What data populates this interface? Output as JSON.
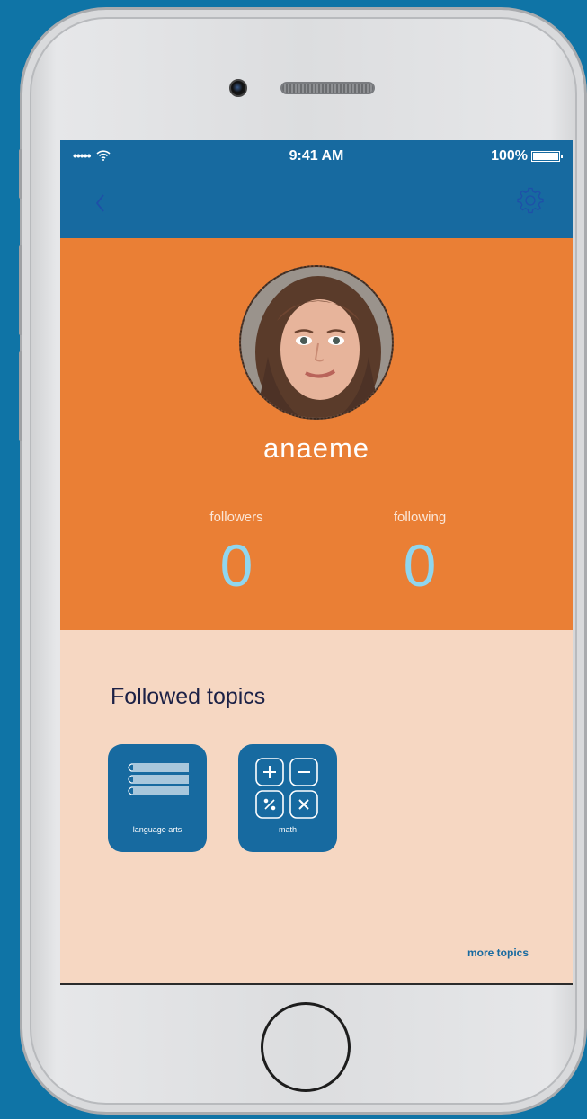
{
  "status_bar": {
    "carrier_signal": "•••••",
    "wifi_icon": "wifi-icon",
    "time": "9:41 AM",
    "battery": "100%"
  },
  "nav": {
    "back_icon": "chevron-left-icon",
    "settings_icon": "gear-icon"
  },
  "profile": {
    "username": "anaeme",
    "followers_label": "followers",
    "followers_count": "0",
    "following_label": "following",
    "following_count": "0"
  },
  "topics": {
    "title": "Followed topics",
    "items": [
      {
        "label": "language arts",
        "icon": "books-icon"
      },
      {
        "label": "math",
        "icon": "calculator-icon"
      }
    ],
    "more_link": "more topics"
  },
  "colors": {
    "background": "#0f74a6",
    "nav_blue": "#176aa0",
    "profile_orange": "#ea7f35",
    "topics_bg": "#f6d7c2",
    "stat_value": "#8fd6ef",
    "title_text": "#1c2146"
  }
}
